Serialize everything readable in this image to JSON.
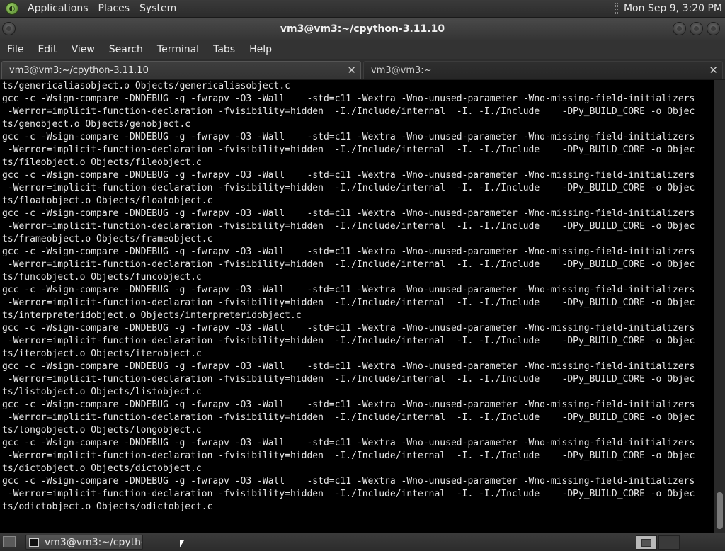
{
  "top_panel": {
    "menus": [
      "Applications",
      "Places",
      "System"
    ],
    "clock": "Mon Sep  9,  3:20 PM"
  },
  "window": {
    "title": "vm3@vm3:~/cpython-3.11.10"
  },
  "menubar": {
    "items": [
      "File",
      "Edit",
      "View",
      "Search",
      "Terminal",
      "Tabs",
      "Help"
    ]
  },
  "tabs": [
    {
      "label": "vm3@vm3:~/cpython-3.11.10",
      "active": true
    },
    {
      "label": "vm3@vm3:~",
      "active": false
    }
  ],
  "terminal": {
    "lines": [
      "ts/genericaliasobject.o Objects/genericaliasobject.c",
      "gcc -c -Wsign-compare -DNDEBUG -g -fwrapv -O3 -Wall    -std=c11 -Wextra -Wno-unused-parameter -Wno-missing-field-initializers",
      " -Werror=implicit-function-declaration -fvisibility=hidden  -I./Include/internal  -I. -I./Include    -DPy_BUILD_CORE -o Objec",
      "ts/genobject.o Objects/genobject.c",
      "gcc -c -Wsign-compare -DNDEBUG -g -fwrapv -O3 -Wall    -std=c11 -Wextra -Wno-unused-parameter -Wno-missing-field-initializers",
      " -Werror=implicit-function-declaration -fvisibility=hidden  -I./Include/internal  -I. -I./Include    -DPy_BUILD_CORE -o Objec",
      "ts/fileobject.o Objects/fileobject.c",
      "gcc -c -Wsign-compare -DNDEBUG -g -fwrapv -O3 -Wall    -std=c11 -Wextra -Wno-unused-parameter -Wno-missing-field-initializers",
      " -Werror=implicit-function-declaration -fvisibility=hidden  -I./Include/internal  -I. -I./Include    -DPy_BUILD_CORE -o Objec",
      "ts/floatobject.o Objects/floatobject.c",
      "gcc -c -Wsign-compare -DNDEBUG -g -fwrapv -O3 -Wall    -std=c11 -Wextra -Wno-unused-parameter -Wno-missing-field-initializers",
      " -Werror=implicit-function-declaration -fvisibility=hidden  -I./Include/internal  -I. -I./Include    -DPy_BUILD_CORE -o Objec",
      "ts/frameobject.o Objects/frameobject.c",
      "gcc -c -Wsign-compare -DNDEBUG -g -fwrapv -O3 -Wall    -std=c11 -Wextra -Wno-unused-parameter -Wno-missing-field-initializers",
      " -Werror=implicit-function-declaration -fvisibility=hidden  -I./Include/internal  -I. -I./Include    -DPy_BUILD_CORE -o Objec",
      "ts/funcobject.o Objects/funcobject.c",
      "gcc -c -Wsign-compare -DNDEBUG -g -fwrapv -O3 -Wall    -std=c11 -Wextra -Wno-unused-parameter -Wno-missing-field-initializers",
      " -Werror=implicit-function-declaration -fvisibility=hidden  -I./Include/internal  -I. -I./Include    -DPy_BUILD_CORE -o Objec",
      "ts/interpreteridobject.o Objects/interpreteridobject.c",
      "gcc -c -Wsign-compare -DNDEBUG -g -fwrapv -O3 -Wall    -std=c11 -Wextra -Wno-unused-parameter -Wno-missing-field-initializers",
      " -Werror=implicit-function-declaration -fvisibility=hidden  -I./Include/internal  -I. -I./Include    -DPy_BUILD_CORE -o Objec",
      "ts/iterobject.o Objects/iterobject.c",
      "gcc -c -Wsign-compare -DNDEBUG -g -fwrapv -O3 -Wall    -std=c11 -Wextra -Wno-unused-parameter -Wno-missing-field-initializers",
      " -Werror=implicit-function-declaration -fvisibility=hidden  -I./Include/internal  -I. -I./Include    -DPy_BUILD_CORE -o Objec",
      "ts/listobject.o Objects/listobject.c",
      "gcc -c -Wsign-compare -DNDEBUG -g -fwrapv -O3 -Wall    -std=c11 -Wextra -Wno-unused-parameter -Wno-missing-field-initializers",
      " -Werror=implicit-function-declaration -fvisibility=hidden  -I./Include/internal  -I. -I./Include    -DPy_BUILD_CORE -o Objec",
      "ts/longobject.o Objects/longobject.c",
      "gcc -c -Wsign-compare -DNDEBUG -g -fwrapv -O3 -Wall    -std=c11 -Wextra -Wno-unused-parameter -Wno-missing-field-initializers",
      " -Werror=implicit-function-declaration -fvisibility=hidden  -I./Include/internal  -I. -I./Include    -DPy_BUILD_CORE -o Objec",
      "ts/dictobject.o Objects/dictobject.c",
      "gcc -c -Wsign-compare -DNDEBUG -g -fwrapv -O3 -Wall    -std=c11 -Wextra -Wno-unused-parameter -Wno-missing-field-initializers",
      " -Werror=implicit-function-declaration -fvisibility=hidden  -I./Include/internal  -I. -I./Include    -DPy_BUILD_CORE -o Objec",
      "ts/odictobject.o Objects/odictobject.c"
    ]
  },
  "taskbar": {
    "task_label": "vm3@vm3:~/cpytho..."
  }
}
